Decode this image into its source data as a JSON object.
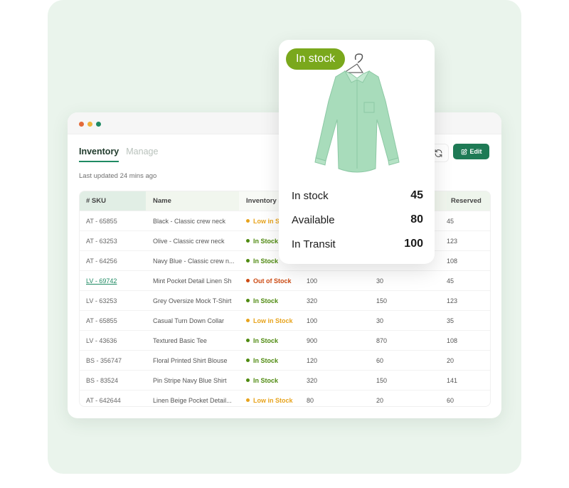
{
  "tabs": [
    {
      "label": "Inventory",
      "active": true
    },
    {
      "label": "Manage",
      "active": false
    }
  ],
  "last_updated": "Last updated 24 mins ago",
  "toolbar": {
    "refresh_icon": "refresh-icon",
    "edit_label": "Edit",
    "edit_icon": "edit-icon"
  },
  "colors": {
    "brand_green": "#1e7a55",
    "badge_green": "#7aa81c",
    "low_stock": "#e7a31c",
    "in_stock": "#4f8a10",
    "out_of_stock": "#cc4a12"
  },
  "table": {
    "headers": [
      "# SKU",
      "Name",
      "Inventory st",
      "",
      "",
      "Reserved"
    ],
    "rows": [
      {
        "sku": "AT - 65855",
        "name": "Black - Classic crew neck",
        "status": "Low in Stock",
        "status_type": "low",
        "c4": "",
        "c5": "",
        "reserved": "45"
      },
      {
        "sku": "AT - 63253",
        "name": "Olive - Classic crew neck",
        "status": "In Stock",
        "status_type": "in",
        "c4": "",
        "c5": "",
        "reserved": "123"
      },
      {
        "sku": "AT - 64256",
        "name": "Navy Blue - Classic crew n...",
        "status": "In Stock",
        "status_type": "in",
        "c4": "",
        "c5": "",
        "reserved": "108"
      },
      {
        "sku": "LV - 69742",
        "name": "Mint Pocket Detail Linen Sh",
        "status": "Out of Stock",
        "status_type": "out",
        "c4": "100",
        "c5": "30",
        "reserved": "45",
        "link": true
      },
      {
        "sku": "LV - 63253",
        "name": "Grey Oversize Mock T-Shirt",
        "status": "In Stock",
        "status_type": "in",
        "c4": "320",
        "c5": "150",
        "reserved": "123"
      },
      {
        "sku": "AT - 65855",
        "name": "Casual Turn Down Collar",
        "status": "Low in Stock",
        "status_type": "low",
        "c4": "100",
        "c5": "30",
        "reserved": "35"
      },
      {
        "sku": "LV - 43636",
        "name": "Textured Basic Tee",
        "status": "In Stock",
        "status_type": "in",
        "c4": "900",
        "c5": "870",
        "reserved": "108"
      },
      {
        "sku": "BS - 356747",
        "name": "Floral Printed Shirt Blouse",
        "status": "In Stock",
        "status_type": "in",
        "c4": "120",
        "c5": "60",
        "reserved": "20"
      },
      {
        "sku": "BS - 83524",
        "name": "Pin Stripe Navy Blue Shirt",
        "status": "In Stock",
        "status_type": "in",
        "c4": "320",
        "c5": "150",
        "reserved": "141"
      },
      {
        "sku": "AT - 642644",
        "name": "Linen Beige Pocket Detail...",
        "status": "Low in Stock",
        "status_type": "low",
        "c4": "80",
        "c5": "20",
        "reserved": "60"
      }
    ]
  },
  "stock_card": {
    "badge": "In stock",
    "metrics": [
      {
        "label": "In stock",
        "value": "45"
      },
      {
        "label": "Available",
        "value": "80"
      },
      {
        "label": "In Transit",
        "value": "100"
      }
    ]
  }
}
